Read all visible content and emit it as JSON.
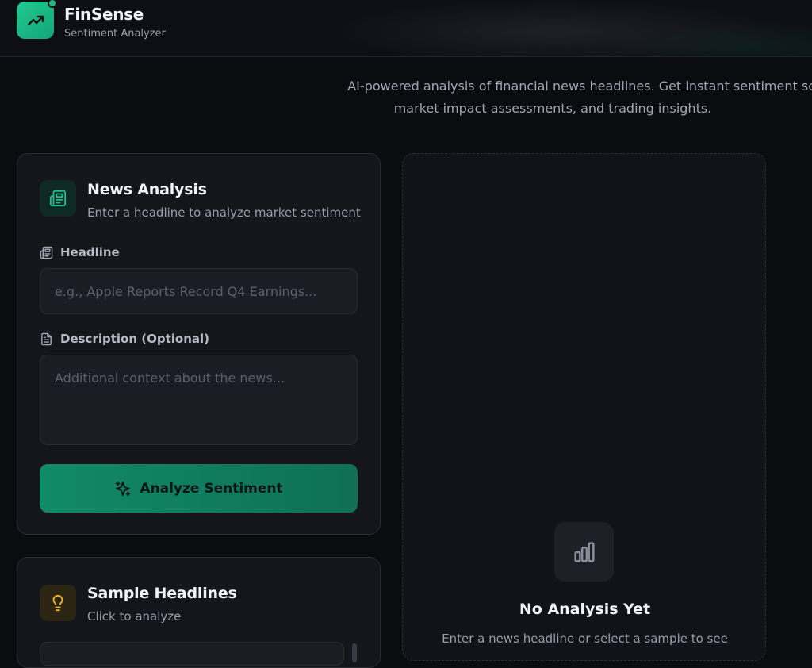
{
  "header": {
    "app_name": "FinSense",
    "app_subtitle": "Sentiment Analyzer",
    "logo_icon": "trending-up-icon"
  },
  "intro": {
    "line1": "AI-powered analysis of financial news headlines. Get instant sentiment sco",
    "line2": "market impact assessments, and trading insights."
  },
  "news_analysis": {
    "title": "News Analysis",
    "subtitle": "Enter a headline to analyze market sentiment",
    "icon": "newspaper-icon",
    "headline_label": "Headline",
    "headline_placeholder": "e.g., Apple Reports Record Q4 Earnings...",
    "headline_value": "",
    "description_label": "Description (Optional)",
    "description_placeholder": "Additional context about the news...",
    "description_value": "",
    "analyze_button": "Analyze Sentiment"
  },
  "samples": {
    "title": "Sample Headlines",
    "subtitle": "Click to analyze",
    "icon": "lightbulb-icon"
  },
  "result": {
    "empty_title": "No Analysis Yet",
    "empty_subtitle": "Enter a news headline or select a sample to see",
    "icon": "bar-chart-icon"
  },
  "colors": {
    "accent": "#13a679",
    "button": "#108a68",
    "amber": "#f0b429",
    "background": "#0b0c10",
    "card": "#15161c"
  }
}
